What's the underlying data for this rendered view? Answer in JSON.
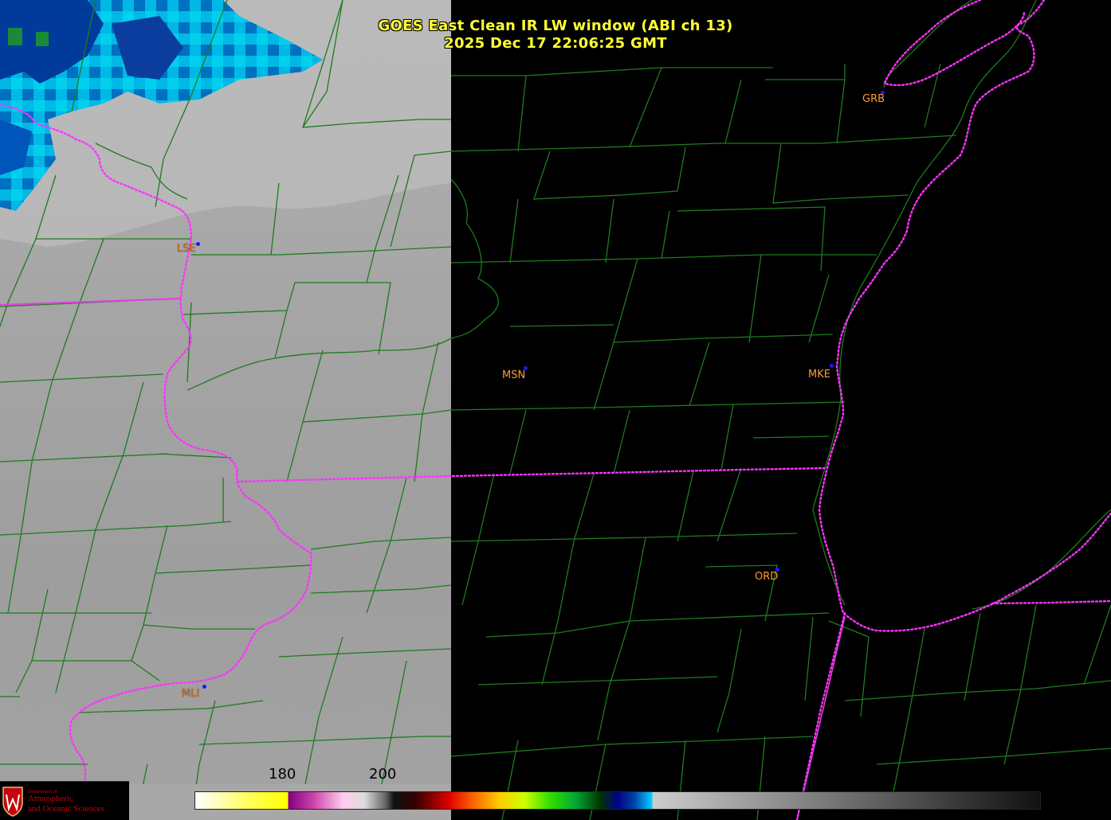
{
  "header": {
    "title": "GOES East Clean IR LW window (ABI ch 13)",
    "timestamp": "2025 Dec 17  22:06:25 GMT"
  },
  "cities": [
    {
      "code": "GRB"
    },
    {
      "code": "LSE"
    },
    {
      "code": "MSN"
    },
    {
      "code": "MKE"
    },
    {
      "code": "ORD"
    },
    {
      "code": "MLI"
    }
  ],
  "colorbar": {
    "tick_labels": [
      "180",
      "200"
    ]
  },
  "logo": {
    "line1": "Department of",
    "line2": "Atmospheric",
    "line3": "and Oceanic Sciences"
  },
  "colors": {
    "county_lines": "#1f7a1f",
    "state_lines": "#ff33ff",
    "title_text": "#ffff33",
    "city_labels": "#ff9933"
  }
}
